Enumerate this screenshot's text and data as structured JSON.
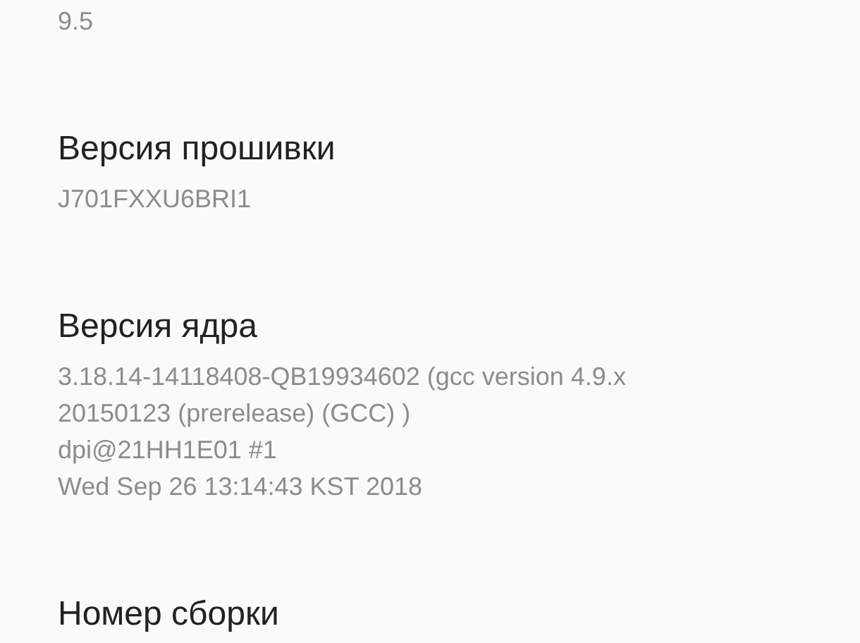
{
  "items": [
    {
      "value": "9.5"
    },
    {
      "title": "Версия прошивки",
      "value": "J701FXXU6BRI1"
    },
    {
      "title": "Версия ядра",
      "value": "3.18.14-14118408-QB19934602 (gcc version 4.9.x\n20150123 (prerelease) (GCC) )\ndpi@21HH1E01 #1\nWed Sep 26 13:14:43 KST 2018"
    },
    {
      "title": "Номер сборки"
    }
  ]
}
